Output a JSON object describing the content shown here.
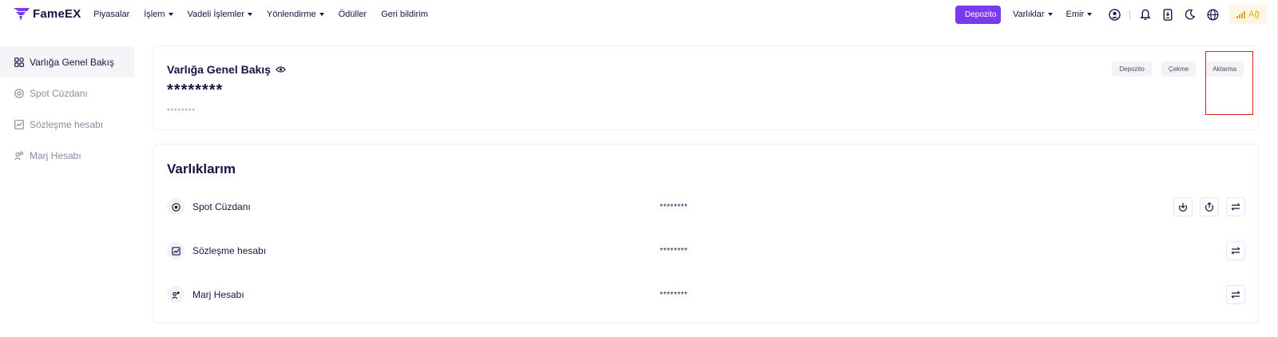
{
  "brand": {
    "name": "FameEX",
    "accent": "#7a3af0"
  },
  "nav": {
    "items": [
      {
        "label": "Piyasalar",
        "dropdown": false
      },
      {
        "label": "İşlem",
        "dropdown": true
      },
      {
        "label": "Vadeli İşlemler",
        "dropdown": true
      },
      {
        "label": "Yönlendirme",
        "dropdown": true
      },
      {
        "label": "Ödüller",
        "dropdown": false
      },
      {
        "label": "Geri bildirim",
        "dropdown": false
      }
    ],
    "deposit_label": "Depozito",
    "assets_label": "Varlıklar",
    "orders_label": "Emir",
    "network_label": "Ağ",
    "icons": [
      "user-icon",
      "bell-icon",
      "download-icon",
      "moon-icon",
      "globe-icon",
      "signal-icon"
    ]
  },
  "sidebar": {
    "items": [
      {
        "label": "Varlığa Genel Bakış",
        "icon": "grid-icon",
        "active": true
      },
      {
        "label": "Spot Cüzdanı",
        "icon": "target-icon",
        "active": false
      },
      {
        "label": "Sözleşme hesabı",
        "icon": "chart-doc-icon",
        "active": false
      },
      {
        "label": "Marj Hesabı",
        "icon": "people-icon",
        "active": false
      }
    ]
  },
  "overview": {
    "title": "Varlığa Genel Bakış",
    "value": "********",
    "sub_value": "********",
    "actions": [
      "Depozito",
      "Çekme",
      "Aktarma"
    ]
  },
  "assets": {
    "title": "Varlıklarım",
    "rows": [
      {
        "name": "Spot Cüzdanı",
        "balance": "********",
        "icon": "target-icon",
        "actions": [
          "deposit-icon",
          "withdraw-icon",
          "transfer-icon"
        ]
      },
      {
        "name": "Sözleşme hesabı",
        "balance": "********",
        "icon": "chart-doc-icon",
        "actions": [
          "transfer-icon"
        ]
      },
      {
        "name": "Marj Hesabı",
        "balance": "********",
        "icon": "people-icon",
        "actions": [
          "transfer-icon"
        ]
      }
    ]
  },
  "annotation": {
    "color": "#e02020",
    "target": "Aktarma"
  }
}
